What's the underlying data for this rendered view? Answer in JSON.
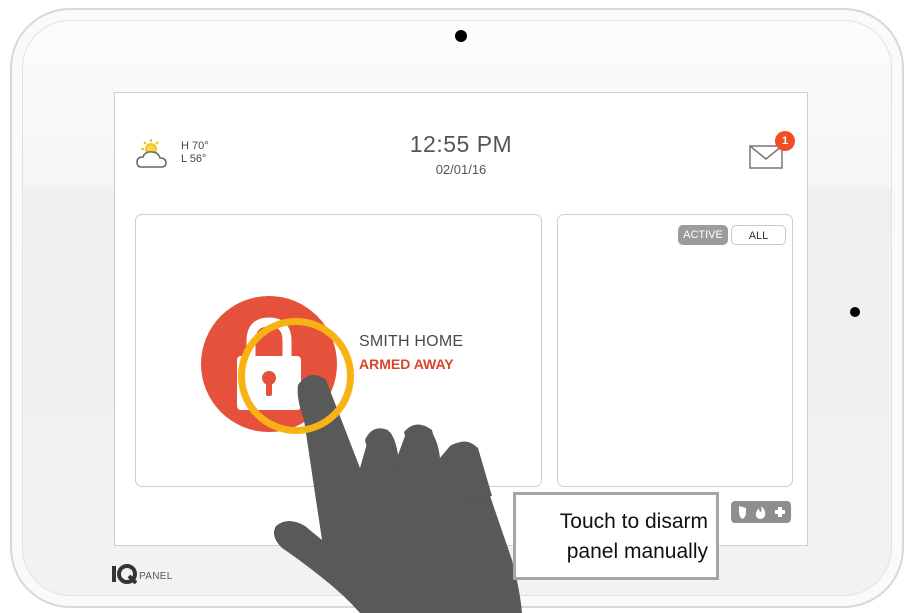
{
  "weather": {
    "high": "H 70°",
    "low": "L 56°",
    "icon": "partly-cloudy-icon"
  },
  "clock": {
    "time": "12:55 PM",
    "date": "02/01/16"
  },
  "notifications": {
    "count": "1",
    "icon": "envelope-icon"
  },
  "system": {
    "name": "SMITH HOME",
    "status": "ARMED AWAY",
    "status_color": "#d8452b",
    "lock_color": "#e5513a"
  },
  "sensor_filter": {
    "active_label": "ACTIVE",
    "all_label": "ALL"
  },
  "status_icons": [
    "shield-icon",
    "flame-icon",
    "medical-cross-icon"
  ],
  "callout": {
    "line1": "Touch to disarm",
    "line2": "panel manually"
  },
  "brand": {
    "text": "PANEL"
  },
  "colors": {
    "highlight_ring": "#f7b214",
    "badge": "#f04e23",
    "hand": "#595959"
  }
}
